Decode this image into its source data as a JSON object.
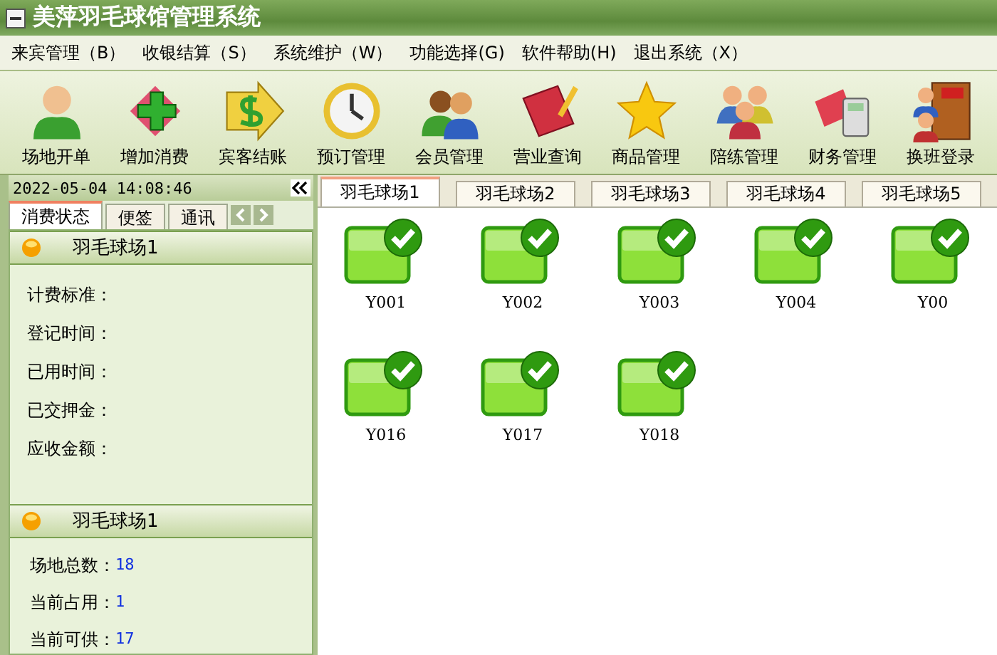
{
  "window": {
    "title": "美萍羽毛球馆管理系统"
  },
  "menu": [
    "来宾管理（B）",
    "收银结算（S）",
    "系统维护（W）",
    "功能选择(G)",
    "软件帮助(H)",
    "退出系统（X）"
  ],
  "toolbar": [
    {
      "label": "场地开单",
      "kind": "person"
    },
    {
      "label": "增加消费",
      "kind": "plus"
    },
    {
      "label": "宾客结账",
      "kind": "dollar"
    },
    {
      "label": "预订管理",
      "kind": "clock"
    },
    {
      "label": "会员管理",
      "kind": "people"
    },
    {
      "label": "营业查询",
      "kind": "book"
    },
    {
      "label": "商品管理",
      "kind": "star"
    },
    {
      "label": "陪练管理",
      "kind": "group"
    },
    {
      "label": "财务管理",
      "kind": "calc"
    },
    {
      "label": "换班登录",
      "kind": "door"
    }
  ],
  "clock": "2022-05-04 14:08:46",
  "side_tabs": [
    {
      "label": "消费状态",
      "selected": true
    },
    {
      "label": "便签",
      "selected": false
    },
    {
      "label": "通讯",
      "selected": false
    }
  ],
  "status_panel": {
    "title": "羽毛球场1",
    "fields": [
      {
        "label": "计费标准："
      },
      {
        "label": "登记时间："
      },
      {
        "label": "已用时间："
      },
      {
        "label": "已交押金："
      },
      {
        "label": "应收金额："
      }
    ]
  },
  "summary_panel": {
    "title": "羽毛球场1",
    "fields": [
      {
        "label": "场地总数：",
        "value": "18"
      },
      {
        "label": "当前占用：",
        "value": "1"
      },
      {
        "label": "当前可供：",
        "value": "17"
      }
    ]
  },
  "court_tabs": [
    {
      "label": "羽毛球场1",
      "selected": true
    },
    {
      "label": "羽毛球场2",
      "selected": false
    },
    {
      "label": "羽毛球场3",
      "selected": false
    },
    {
      "label": "羽毛球场4",
      "selected": false
    },
    {
      "label": "羽毛球场5",
      "selected": false
    }
  ],
  "courts": [
    {
      "label": "Y001",
      "kind": "free"
    },
    {
      "label": "Y002",
      "kind": "free"
    },
    {
      "label": "Y003",
      "kind": "free"
    },
    {
      "label": "Y004",
      "kind": "free"
    },
    {
      "label": "Y00",
      "kind": "free"
    },
    {
      "label": "Y016",
      "kind": "free"
    },
    {
      "label": "Y017",
      "kind": "free"
    },
    {
      "label": "Y018",
      "kind": "free"
    }
  ]
}
